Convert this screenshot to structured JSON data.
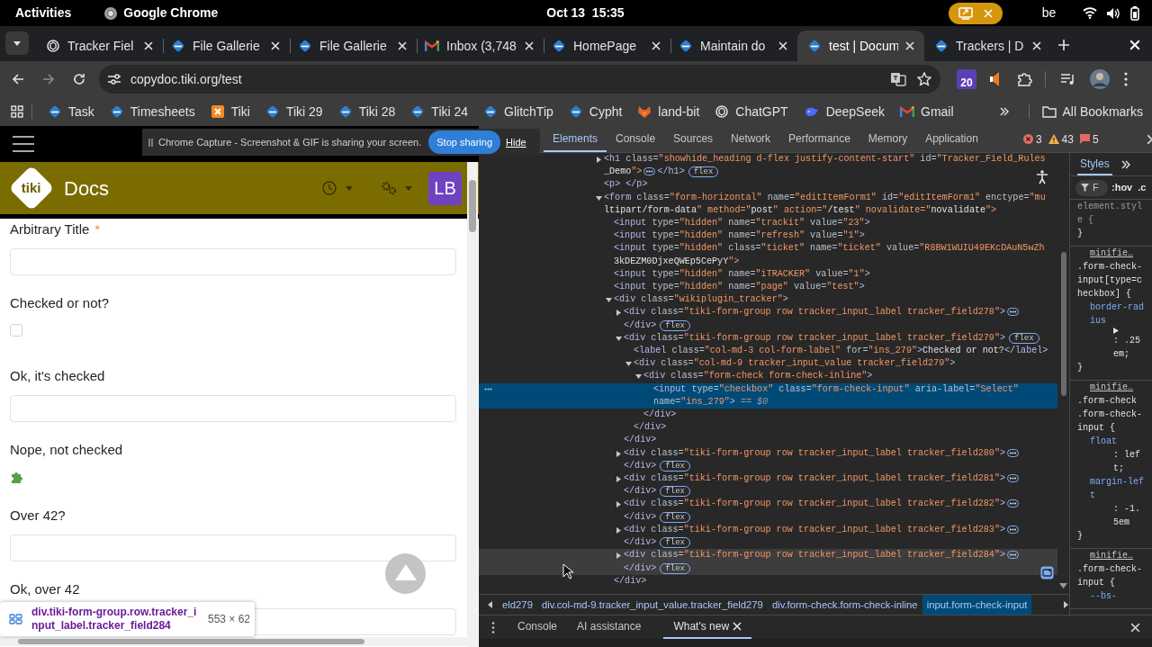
{
  "system_bar": {
    "activities": "Activities",
    "app_name": "Google Chrome",
    "date_time": "Oct 13  15:35",
    "keyboard_layout": "be"
  },
  "tabs": [
    {
      "title": "Tracker Fiel",
      "kind": "knot",
      "selected": false
    },
    {
      "title": "File Gallerie",
      "kind": "diamond",
      "selected": false
    },
    {
      "title": "File Gallerie",
      "kind": "diamond",
      "selected": false
    },
    {
      "title": "Inbox (3,748",
      "kind": "envelope",
      "selected": false
    },
    {
      "title": "HomePage",
      "kind": "diamond",
      "selected": false
    },
    {
      "title": "Maintain do",
      "kind": "diamond",
      "selected": false
    },
    {
      "title": "test | Docum",
      "kind": "diamond",
      "selected": true
    },
    {
      "title": "Trackers | D",
      "kind": "diamond",
      "selected": false
    }
  ],
  "address_bar": {
    "url": "copydoc.tiki.org/test"
  },
  "toolbar": {
    "calendar_badge": "20"
  },
  "bookmarks": [
    {
      "label": "Task",
      "kind": "diamond"
    },
    {
      "label": "Timesheets",
      "kind": "diamond"
    },
    {
      "label": "Tiki",
      "kind": "squarex"
    },
    {
      "label": "Tiki 29",
      "kind": "diamond"
    },
    {
      "label": "Tiki 28",
      "kind": "diamond"
    },
    {
      "label": "Tiki 24",
      "kind": "diamond"
    },
    {
      "label": "GlitchTip",
      "kind": "diamond"
    },
    {
      "label": "Cypht",
      "kind": "diamond"
    },
    {
      "label": "land-bit",
      "kind": "fox"
    },
    {
      "label": "ChatGPT",
      "kind": "knot"
    },
    {
      "label": "DeepSeek",
      "kind": "whale"
    },
    {
      "label": "Gmail",
      "kind": "envelope"
    }
  ],
  "all_bookmarks": "All Bookmarks",
  "page": {
    "sharing_bar": {
      "message": "Chrome Capture - Screenshot & GIF is sharing your screen.",
      "stop": "Stop sharing",
      "hide": "Hide"
    },
    "logo_text": "tiki",
    "site_title": "Docs",
    "avatar": "LB",
    "fields": [
      {
        "label": "Arbitrary Title",
        "required_mark": "*",
        "kind": "text"
      },
      {
        "label": "Checked or not?",
        "kind": "checkbox",
        "checked": false
      },
      {
        "label": "Ok, it's checked",
        "kind": "text"
      },
      {
        "label": "Nope, not checked",
        "kind": "icon"
      },
      {
        "label": "Over 42?",
        "kind": "text"
      },
      {
        "label": "Ok, over 42",
        "kind": "text"
      }
    ],
    "inspect_tooltip": {
      "selector": "div.tiki-form-group.row.tracker_input_label.tracker_field284",
      "size": "553 × 62"
    }
  },
  "devtools": {
    "tabs": [
      {
        "label": "Elements",
        "selected": true
      },
      {
        "label": "Console",
        "selected": false
      },
      {
        "label": "Sources",
        "selected": false
      },
      {
        "label": "Network",
        "selected": false
      },
      {
        "label": "Performance",
        "selected": false
      },
      {
        "label": "Memory",
        "selected": false
      },
      {
        "label": "Application",
        "selected": false
      }
    ],
    "errors": "3",
    "warnings": "43",
    "issues": "5",
    "dom_tree": [
      {
        "open": [
          "<h1 class=\"showhide_heading d-flex justify-content-start\" id=\"Tracker_Field_Rules",
          "_Demo\">"
        ],
        "close": "</h1>",
        "badge": "flex",
        "expanded": false,
        "selected": false,
        "hovered": false
      },
      {
        "open": "<p> </p>",
        "selected": false,
        "hovered": false
      },
      {
        "open": [
          "<form class=\"form-horizontal\" name=\"editItemForm1\" id=\"editItemForm1\" enctype=\"mu",
          "ltipart/form-data\" method=\"post\" action=\"/test\" novalidate=\"novalidate\">"
        ],
        "expanded": true,
        "selected": false,
        "hovered": false,
        "children": [
          {
            "open": "<input type=\"hidden\" name=\"trackit\" value=\"23\">",
            "selected": false,
            "hovered": false
          },
          {
            "open": "<input type=\"hidden\" name=\"refresh\" value=\"1\">",
            "selected": false,
            "hovered": false
          },
          {
            "open": [
              "<input type=\"hidden\" class=\"ticket\" name=\"ticket\" value=\"R8BW1WUIU49EKcDAuN5wZh",
              "3kDEZM0DjxeQWEp5CePyY\">"
            ],
            "selected": false,
            "hovered": false
          },
          {
            "open": "<input type=\"hidden\" name=\"iTRACKER\" value=\"1\">",
            "selected": false,
            "hovered": false
          },
          {
            "open": "<input type=\"hidden\" name=\"page\" value=\"test\">",
            "selected": false,
            "hovered": false
          },
          {
            "open": "<div class=\"wikiplugin_tracker\">",
            "close": "</div>",
            "expanded": true,
            "selected": false,
            "hovered": false,
            "children": [
              {
                "open": "<div class=\"tiki-form-group row tracker_input_label tracker_field278\">",
                "close": "</div>",
                "badge": "flex",
                "expanded": false,
                "selected": false,
                "hovered": false
              },
              {
                "open": "<div class=\"tiki-form-group row tracker_input_label tracker_field279\">",
                "close": "</div>",
                "badge": "flex",
                "expanded": true,
                "selected": false,
                "hovered": false,
                "children": [
                  {
                    "open": "<label class=\"col-md-3 col-form-label\" for=\"ins_279\">Checked or not?</label>",
                    "selected": false,
                    "hovered": false
                  },
                  {
                    "open": "<div class=\"col-md-9 tracker_input_value tracker_field279\">",
                    "close": "</div>",
                    "expanded": true,
                    "selected": false,
                    "hovered": false,
                    "children": [
                      {
                        "open": "<div class=\"form-check form-check-inline\">",
                        "close": "</div>",
                        "expanded": true,
                        "selected": false,
                        "hovered": false,
                        "children": [
                          {
                            "open": [
                              "<input type=\"checkbox\" class=\"form-check-input\" aria-label=\"Select\"",
                              "name=\"ins_279\">"
                            ],
                            "suffix": "== $0",
                            "selected": true,
                            "hovered": false
                          }
                        ]
                      }
                    ]
                  }
                ]
              },
              {
                "open": "<div class=\"tiki-form-group row tracker_input_label tracker_field280\">",
                "close": "</div>",
                "badge": "flex",
                "expanded": false,
                "selected": false,
                "hovered": false
              },
              {
                "open": "<div class=\"tiki-form-group row tracker_input_label tracker_field281\">",
                "close": "</div>",
                "badge": "flex",
                "expanded": false,
                "selected": false,
                "hovered": false
              },
              {
                "open": "<div class=\"tiki-form-group row tracker_input_label tracker_field282\">",
                "close": "</div>",
                "badge": "flex",
                "expanded": false,
                "selected": false,
                "hovered": false
              },
              {
                "open": "<div class=\"tiki-form-group row tracker_input_label tracker_field283\">",
                "close": "</div>",
                "badge": "flex",
                "expanded": false,
                "selected": false,
                "hovered": false
              },
              {
                "open": "<div class=\"tiki-form-group row tracker_input_label tracker_field284\">",
                "close": "</div>",
                "badge": "flex",
                "expanded": false,
                "selected": false,
                "hovered": true
              }
            ]
          }
        ]
      }
    ],
    "breadcrumbs": [
      {
        "label": "eld279",
        "selected": false
      },
      {
        "label": "div.col-md-9.tracker_input_value.tracker_field279",
        "selected": false
      },
      {
        "label": "div.form-check.form-check-inline",
        "selected": false
      },
      {
        "label": "input.form-check-input",
        "selected": true
      }
    ],
    "styles": {
      "tab": "Styles",
      "filter_placeholder": "F",
      "hov": ":hov",
      "cls": ".c",
      "rules": [
        {
          "selector": "element.style {",
          "close": "}"
        },
        {
          "source": "minifie…",
          "selector": ".form-check-input[type=checkbox] {",
          "declarations": [
            {
              "property": "border-radius",
              "value": ": .25em;",
              "expandable": true
            }
          ],
          "close": "}"
        },
        {
          "source": "minifie…",
          "selector": ".form-check .form-check-input {",
          "declarations": [
            {
              "property": "float",
              "value": ": left;"
            },
            {
              "property": "margin-left",
              "value": ": -1.5em"
            }
          ],
          "close": "}"
        },
        {
          "source": "minifie…",
          "selector": ".form-check-input {",
          "declarations": [
            {
              "property": "--bs-"
            }
          ]
        }
      ]
    },
    "drawer_tabs": [
      {
        "label": "Console",
        "selected": false,
        "closable": false
      },
      {
        "label": "AI assistance",
        "selected": false,
        "closable": false
      },
      {
        "label": "What's new",
        "selected": true,
        "closable": true
      }
    ]
  }
}
